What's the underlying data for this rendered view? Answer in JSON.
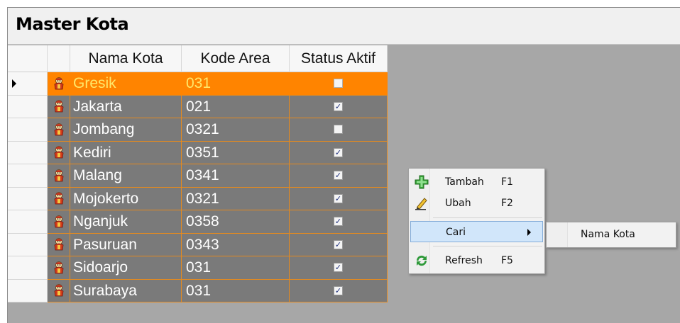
{
  "window": {
    "title": "Master Kota"
  },
  "grid": {
    "columns": [
      "Nama Kota",
      "Kode Area",
      "Status Aktif"
    ],
    "rows": [
      {
        "nama": "Gresik",
        "kode": "031",
        "aktif": false,
        "selected": true
      },
      {
        "nama": "Jakarta",
        "kode": "021",
        "aktif": true
      },
      {
        "nama": "Jombang",
        "kode": "0321",
        "aktif": false
      },
      {
        "nama": "Kediri",
        "kode": "0351",
        "aktif": true
      },
      {
        "nama": "Malang",
        "kode": "0341",
        "aktif": true
      },
      {
        "nama": "Mojokerto",
        "kode": "0321",
        "aktif": true
      },
      {
        "nama": "Nganjuk",
        "kode": "0358",
        "aktif": true
      },
      {
        "nama": "Pasuruan",
        "kode": "0343",
        "aktif": true
      },
      {
        "nama": "Sidoarjo",
        "kode": "031",
        "aktif": true
      },
      {
        "nama": "Surabaya",
        "kode": "031",
        "aktif": true
      }
    ]
  },
  "context_menu": {
    "items": [
      {
        "label": "Tambah",
        "shortcut": "F1",
        "icon": "add-icon"
      },
      {
        "label": "Ubah",
        "shortcut": "F2",
        "icon": "pencil-icon"
      },
      {
        "label": "Cari",
        "shortcut": "",
        "icon": "",
        "submenu": true
      },
      {
        "label": "Refresh",
        "shortcut": "F5",
        "icon": "refresh-icon"
      }
    ],
    "submenu": {
      "items": [
        {
          "label": "Nama Kota"
        }
      ]
    }
  },
  "colors": {
    "selected_row": "#ff8400",
    "row_bg": "#7a7a7a",
    "grid_line": "#e58a1e",
    "selected_text": "#ffe86a",
    "menu_highlight": "#d1e6fa"
  }
}
